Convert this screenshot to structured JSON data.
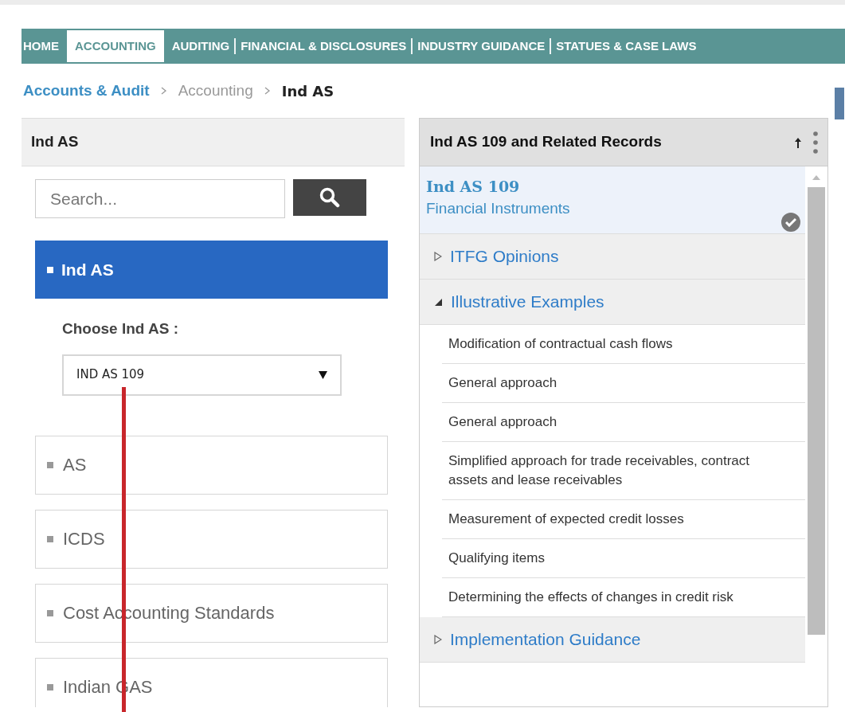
{
  "nav": [
    {
      "label": "HOME",
      "selected": false
    },
    {
      "label": "ACCOUNTING",
      "selected": true
    },
    {
      "label": "AUDITING",
      "selected": false
    },
    {
      "label": "FINANCIAL & DISCLOSURES",
      "selected": false
    },
    {
      "label": "INDUSTRY GUIDANCE",
      "selected": false
    },
    {
      "label": "STATUES & CASE LAWS",
      "selected": false
    }
  ],
  "breadcrumb": [
    {
      "label": "Accounts & Audit",
      "kind": "link"
    },
    {
      "label": "Accounting",
      "kind": "muted"
    },
    {
      "label": "Ind AS",
      "kind": "current"
    }
  ],
  "left_panel": {
    "title": "Ind AS",
    "search": {
      "placeholder": "Search..."
    },
    "categories": [
      {
        "label": "Ind AS",
        "selected": true
      },
      {
        "label": "AS",
        "selected": false
      },
      {
        "label": "ICDS",
        "selected": false
      },
      {
        "label": "Cost Accounting Standards",
        "selected": false
      },
      {
        "label": "Indian GAS",
        "selected": false
      }
    ],
    "chooser": {
      "label": "Choose Ind AS :",
      "value": "IND AS 109"
    }
  },
  "right_panel": {
    "title": "Ind AS 109 and Related Records",
    "record": {
      "code": "Ind AS 109",
      "name": "Financial Instruments",
      "checked": true
    },
    "sections": [
      {
        "label": "ITFG Opinions",
        "expanded": false
      },
      {
        "label": "Illustrative Examples",
        "expanded": true,
        "children": [
          "Modification of contractual cash flows",
          "General approach",
          "General approach",
          "Simplified approach for trade receivables, contract assets and lease receivables",
          "Measurement of expected credit losses",
          "Qualifying items",
          "Determining the effects of changes in credit risk"
        ]
      },
      {
        "label": "Implementation Guidance",
        "expanded": false
      }
    ]
  }
}
